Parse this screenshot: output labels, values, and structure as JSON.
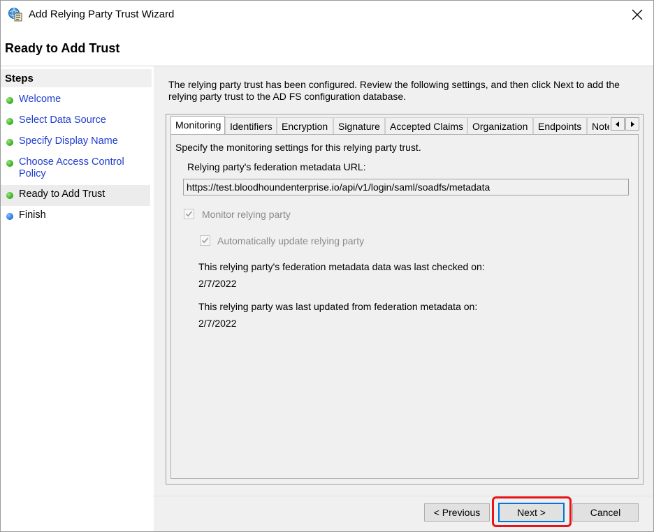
{
  "window": {
    "title": "Add Relying Party Trust Wizard",
    "app_icon": "adfs-relying-party-icon",
    "close_icon": "close-icon"
  },
  "header": {
    "page_title": "Ready to Add Trust"
  },
  "steps": {
    "heading": "Steps",
    "items": [
      {
        "label": "Welcome",
        "status": "completed",
        "is_link": true
      },
      {
        "label": "Select Data Source",
        "status": "completed",
        "is_link": true
      },
      {
        "label": "Specify Display Name",
        "status": "completed",
        "is_link": true
      },
      {
        "label": "Choose Access Control Policy",
        "status": "completed",
        "is_link": true
      },
      {
        "label": "Ready to Add Trust",
        "status": "current",
        "is_link": false
      },
      {
        "label": "Finish",
        "status": "pending",
        "is_link": false
      }
    ]
  },
  "main": {
    "description": "The relying party trust has been configured. Review the following settings, and then click Next to add the relying party trust to the AD FS configuration database.",
    "tabs": [
      {
        "label": "Monitoring",
        "active": true
      },
      {
        "label": "Identifiers",
        "active": false
      },
      {
        "label": "Encryption",
        "active": false
      },
      {
        "label": "Signature",
        "active": false
      },
      {
        "label": "Accepted Claims",
        "active": false
      },
      {
        "label": "Organization",
        "active": false
      },
      {
        "label": "Endpoints",
        "active": false
      },
      {
        "label": "Note",
        "active": false
      }
    ],
    "monitoring": {
      "intro": "Specify the monitoring settings for this relying party trust.",
      "url_label": "Relying party's federation metadata URL:",
      "url_value": "https://test.bloodhoundenterprise.io/api/v1/login/saml/soadfs/metadata",
      "monitor_label": "Monitor relying party",
      "monitor_checked": true,
      "auto_update_label": "Automatically update relying party",
      "auto_update_checked": true,
      "last_checked_label": "This relying party's federation metadata data was last checked on:",
      "last_checked_value": "2/7/2022",
      "last_updated_label": "This relying party was last updated from federation metadata on:",
      "last_updated_value": "2/7/2022"
    }
  },
  "buttons": {
    "previous": "< Previous",
    "next": "Next >",
    "cancel": "Cancel"
  },
  "colors": {
    "link": "#1f3dcf",
    "completed_dot": "#3fae2a",
    "pending_dot": "#2b78e4",
    "highlight": "#e8141a",
    "default_button_border": "#0078d7"
  }
}
